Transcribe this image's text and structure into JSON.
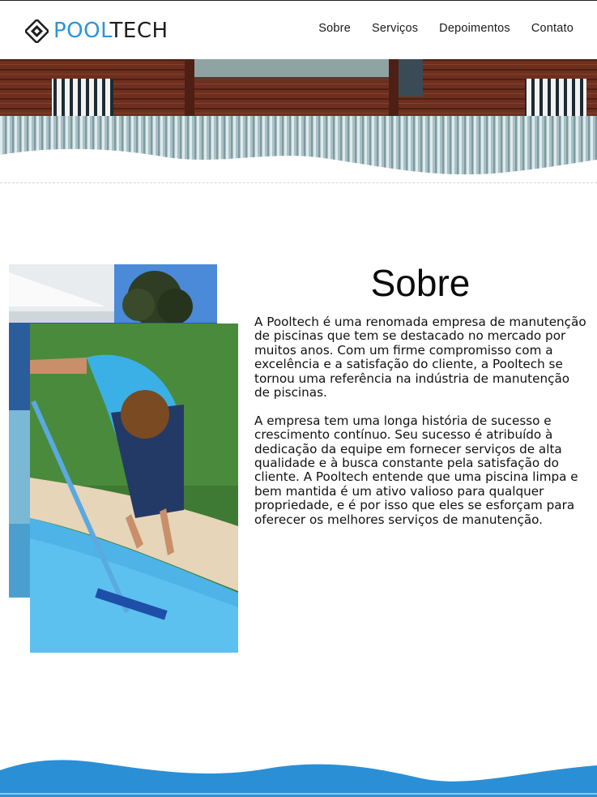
{
  "header": {
    "logo": {
      "part1": "POOL",
      "part2": "TECH"
    },
    "nav": [
      {
        "label": "Sobre"
      },
      {
        "label": "Serviços"
      },
      {
        "label": "Depoimentos"
      },
      {
        "label": "Contato"
      }
    ]
  },
  "about": {
    "title": "Sobre",
    "paragraphs": [
      "A Pooltech é uma renomada empresa de manutenção de piscinas que tem se destacado no mercado por muitos anos. Com um firme compromisso com a excelência e a satisfação do cliente, a Pooltech se tornou uma referência na indústria de manutenção de piscinas.",
      "A empresa tem uma longa história de sucesso e crescimento contínuo. Seu sucesso é atribuído à dedicação da equipe em fornecer serviços de alta qualidade e à busca constante pela satisfação do cliente. A Pooltech entende que uma piscina limpa e bem mantida é um ativo valioso para qualquer propriedade, e é por isso que eles se esforçam para oferecer os melhores serviços de manutenção."
    ]
  },
  "colors": {
    "brand_blue": "#2b95d6",
    "brand_dark": "#1d1d1d",
    "footer_wave": "#2b8fd6"
  },
  "icons": [
    "diamond-logo-icon"
  ]
}
